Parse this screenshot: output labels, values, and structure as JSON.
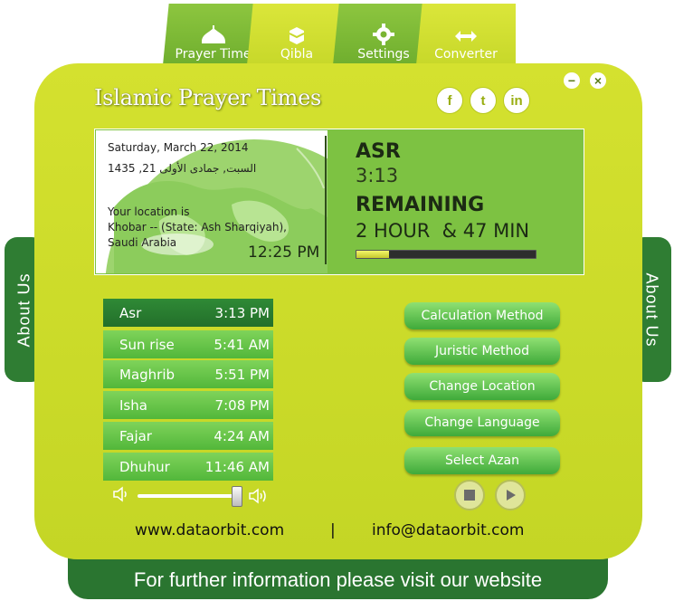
{
  "tabs": [
    {
      "label": "Prayer Time",
      "icon": "mosque-icon"
    },
    {
      "label": "Qibla",
      "icon": "kaaba-icon"
    },
    {
      "label": "Settings",
      "icon": "gear-icon"
    },
    {
      "label": "Converter",
      "icon": "swap-arrows-icon"
    }
  ],
  "side_tabs": {
    "left": "About Us",
    "right": "About Us"
  },
  "app_title": "Islamic Prayer Times",
  "window_controls": {
    "minimize": "−",
    "close": "×"
  },
  "social": {
    "facebook": "f",
    "twitter": "t",
    "linkedin": "in"
  },
  "info": {
    "gregorian_date": "Saturday, March 22, 2014",
    "hijri_date": "السبت, جمادى الأولى 21, 1435",
    "location_label": "Your location is",
    "location_line1": "Khobar -- (State: Ash Sharqiyah),",
    "location_line2": "Saudi Arabia",
    "current_time": "12:25 PM"
  },
  "next_prayer": {
    "name": "ASR",
    "time": "3:13",
    "remaining_label": "REMAINING",
    "remaining_value": "2 HOUR  & 47 MIN",
    "progress_fraction": 0.18
  },
  "prayers": [
    {
      "name": "Asr",
      "time": "3:13 PM",
      "active": true
    },
    {
      "name": "Sun rise",
      "time": "5:41 AM",
      "active": false
    },
    {
      "name": "Maghrib",
      "time": "5:51 PM",
      "active": false
    },
    {
      "name": "Isha",
      "time": "7:08 PM",
      "active": false
    },
    {
      "name": "Fajar",
      "time": "4:24 AM",
      "active": false
    },
    {
      "name": "Dhuhur",
      "time": "11:46 AM",
      "active": false
    }
  ],
  "volume_fraction": 0.97,
  "buttons": [
    "Calculation Method",
    "Juristic Method",
    "Change Location",
    "Change Language",
    "Select Azan"
  ],
  "contact": {
    "website": "www.dataorbit.com",
    "separator": "|",
    "email": "info@dataorbit.com"
  },
  "footer_text": "For further information please visit our website",
  "colors": {
    "panel": "#c9da2a",
    "dark_green": "#2a7530",
    "button_green": "#52b73a",
    "info_box": "#7dc242"
  }
}
